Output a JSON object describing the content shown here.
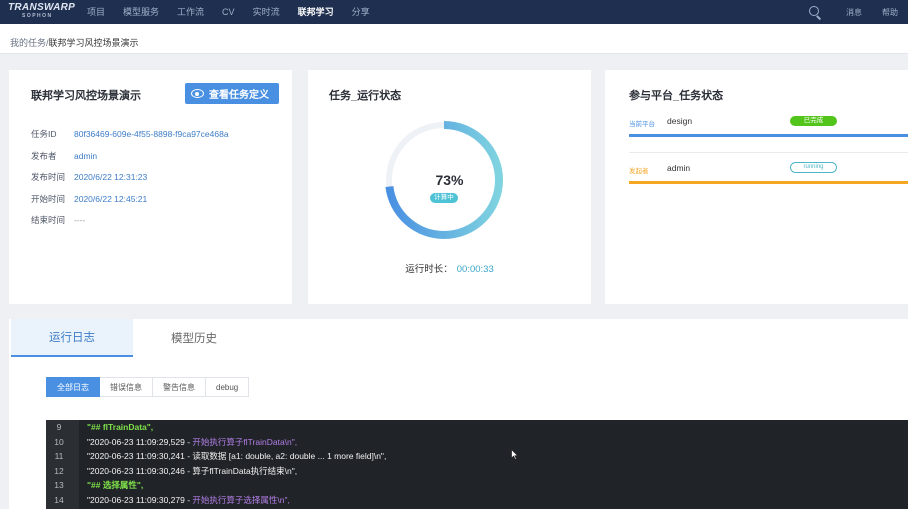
{
  "brand": {
    "line1": "TRANSWARP",
    "line2": "SOPHON"
  },
  "nav": {
    "items": [
      {
        "label": "项目",
        "active": false
      },
      {
        "label": "模型服务",
        "active": false
      },
      {
        "label": "工作流",
        "active": false
      },
      {
        "label": "CV",
        "active": false
      },
      {
        "label": "实时流",
        "active": false
      },
      {
        "label": "联邦学习",
        "active": true
      },
      {
        "label": "分享",
        "active": false
      }
    ],
    "right": {
      "messages": "消息",
      "help": "帮助"
    }
  },
  "breadcrumb": {
    "parent": "我的任务",
    "separator": "/",
    "current": "联邦学习风控场景演示"
  },
  "task_card": {
    "title": "联邦学习风控场景演示",
    "view_button": "查看任务定义",
    "fields": [
      {
        "key": "任务ID",
        "value": "80f36469-609e-4f55-8898-f9ca97ce468a"
      },
      {
        "key": "发布者",
        "value": "admin"
      },
      {
        "key": "发布时间",
        "value": "2020/6/22  12:31:23"
      },
      {
        "key": "开始时间",
        "value": "2020/6/22  12:45:21"
      },
      {
        "key": "结束时间",
        "value": "----"
      }
    ]
  },
  "status_card": {
    "title": "任务_运行状态",
    "progress_percent": 73,
    "progress_label": "73%",
    "badge": "计算中",
    "runtime_label": "运行时长：",
    "runtime_value": "00:00:33"
  },
  "platform_card": {
    "title": "参与平台_任务状态",
    "rows": [
      {
        "label": "当前平台",
        "name": "design",
        "status": "已完成",
        "color": "#4a90e2",
        "label_color": "#4a90e2"
      },
      {
        "label": "发起者",
        "name": "admin",
        "status": "running",
        "color": "#f5a623",
        "label_color": "#f5a623"
      }
    ]
  },
  "log_panel": {
    "tabs": [
      {
        "label": "运行日志",
        "active": true
      },
      {
        "label": "模型历史",
        "active": false
      }
    ],
    "filters": [
      {
        "label": "全部日志",
        "active": true
      },
      {
        "label": "错误信息",
        "active": false
      },
      {
        "label": "警告信息",
        "active": false
      },
      {
        "label": "debug",
        "active": false
      }
    ],
    "lines": [
      {
        "n": "9",
        "parts": [
          {
            "t": "\"## flTrainData\",",
            "c": "g"
          }
        ]
      },
      {
        "n": "10",
        "parts": [
          {
            "t": "\"2020-06-23 11:09:29,529 - ",
            "c": ""
          },
          {
            "t": "开始执行算子flTrainData\\n\",",
            "c": "p"
          }
        ]
      },
      {
        "n": "11",
        "parts": [
          {
            "t": "\"2020-06-23 11:09:30,241 - 读取数据 [a1: double, a2: double ... 1 more field]\\n\",",
            "c": ""
          }
        ]
      },
      {
        "n": "12",
        "parts": [
          {
            "t": "\"2020-06-23 11:09:30,246 - 算子flTrainData执行结束\\n\",",
            "c": ""
          }
        ]
      },
      {
        "n": "13",
        "parts": [
          {
            "t": "\"## 选择属性\",",
            "c": "g"
          }
        ]
      },
      {
        "n": "14",
        "parts": [
          {
            "t": "\"2020-06-23 11:09:30,279 - ",
            "c": ""
          },
          {
            "t": "开始执行算子选择属性\\n\",",
            "c": "p"
          }
        ]
      }
    ]
  },
  "colors": {
    "nav_bg": "#1e2f4f",
    "accent": "#4a90e2",
    "ring_start": "#4a90e2",
    "ring_end": "#7fd3e0",
    "console_bg": "#202428",
    "success": "#52c41a",
    "warning": "#f5a623"
  }
}
